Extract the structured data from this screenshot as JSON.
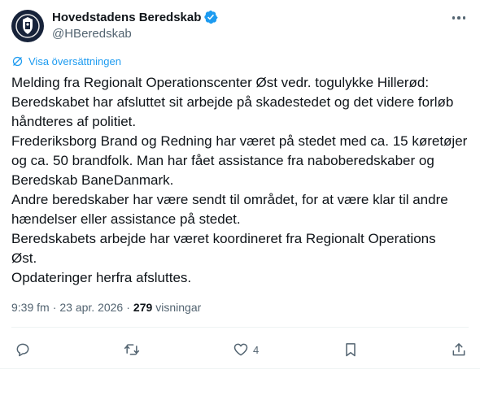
{
  "author": {
    "display_name": "Hovedstadens Beredskab",
    "handle": "@HBeredskab"
  },
  "translate_label": "Visa översättningen",
  "body_lines": [
    "Melding fra Regionalt Operationscenter Øst vedr. togulykke Hillerød:",
    "Beredskabet har afsluttet sit arbejde på skadestedet og det videre forløb",
    "håndteres af politiet.",
    "Frederiksborg Brand og Redning har været på stedet med ca. 15 køretøjer",
    "og ca. 50 brandfolk. Man har fået assistance fra naboberedskaber og",
    "Beredskab BaneDanmark.",
    "Andre beredskaber har være sendt til området, for at være klar til andre",
    "hændelser eller assistance på stedet.",
    "Beredskabets arbejde har været koordineret fra Regionalt Operations",
    "Øst.",
    "Opdateringer herfra afsluttes."
  ],
  "meta": {
    "time": "9:39 fm",
    "separator": "·",
    "date": "23 apr. 2026",
    "separator2": "·",
    "view_count": "279",
    "views_label": "visningar"
  },
  "actions": {
    "reply_count": "",
    "retweet_count": "",
    "like_count": "4"
  },
  "colors": {
    "accent": "#1d9bf0",
    "secondary_text": "#536471",
    "avatar_bg": "#17233a"
  },
  "icons": [
    "verified-badge-icon",
    "more-icon",
    "translate-icon",
    "reply-icon",
    "retweet-icon",
    "like-icon",
    "bookmark-icon",
    "share-icon"
  ]
}
